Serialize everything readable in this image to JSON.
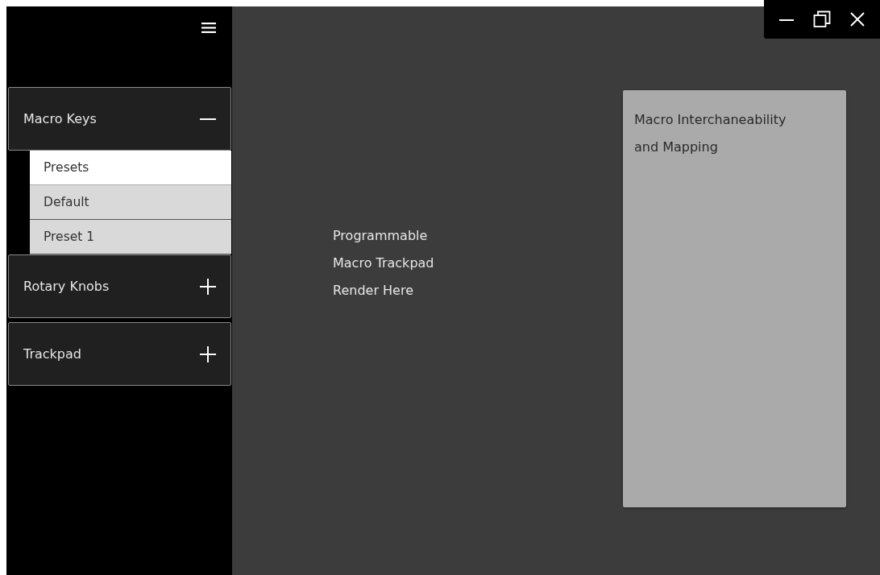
{
  "sidebar": {
    "sections": [
      {
        "label": "Macro Keys",
        "expanded": true,
        "children": [
          {
            "label": "Presets",
            "selected": true
          },
          {
            "label": "Default",
            "selected": false
          },
          {
            "label": "Preset 1",
            "selected": false
          }
        ]
      },
      {
        "label": "Rotary Knobs",
        "expanded": false
      },
      {
        "label": "Trackpad",
        "expanded": false
      }
    ]
  },
  "main": {
    "placeholder_lines": [
      "Programmable",
      "Macro Trackpad",
      "Render Here"
    ]
  },
  "panel": {
    "lines": [
      "Macro Interchaneability",
      "and Mapping"
    ]
  }
}
